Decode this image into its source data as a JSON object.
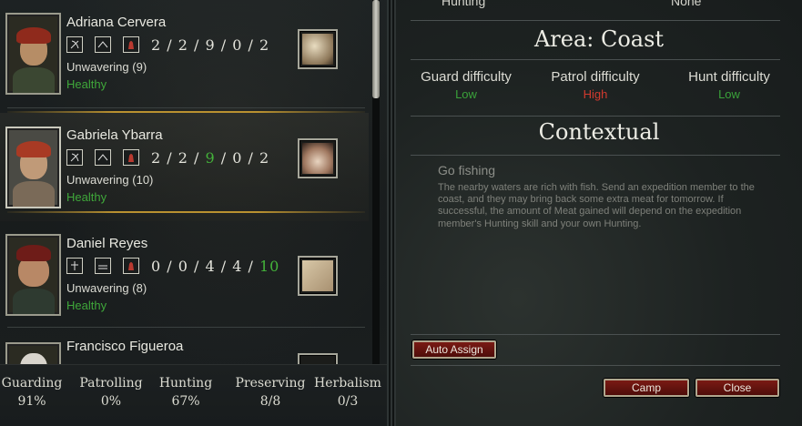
{
  "roster": [
    {
      "name": "Adriana Cervera",
      "stats": [
        "2",
        "2",
        "9",
        "0",
        "2"
      ],
      "stat_highlight": [],
      "trait": "Unwavering (9)",
      "status": "Healthy",
      "skill_icons": [
        "bow-icon",
        "tent-icon",
        "hood-icon"
      ]
    },
    {
      "name": "Gabriela Ybarra",
      "stats": [
        "2",
        "2",
        "9",
        "0",
        "2"
      ],
      "stat_highlight": [
        2
      ],
      "trait": "Unwavering (10)",
      "status": "Healthy",
      "skill_icons": [
        "bow-icon",
        "tent-icon",
        "hood-icon"
      ]
    },
    {
      "name": "Daniel Reyes",
      "stats": [
        "0",
        "0",
        "4",
        "4",
        "10"
      ],
      "stat_highlight": [
        4
      ],
      "trait": "Unwavering (8)",
      "status": "Healthy",
      "skill_icons": [
        "cross-icon",
        "bed-icon",
        "hood-icon"
      ]
    },
    {
      "name": "Francisco Figueroa",
      "stats": [],
      "stat_highlight": [],
      "trait": "",
      "status": "",
      "skill_icons": []
    }
  ],
  "summary": [
    {
      "label": "Guarding",
      "value": "91%"
    },
    {
      "label": "Patrolling",
      "value": "0%"
    },
    {
      "label": "Hunting",
      "value": "67%"
    },
    {
      "label": "Preserving",
      "value": "8/8"
    },
    {
      "label": "Herbalism",
      "value": "0/3"
    }
  ],
  "assignment_row": {
    "label": "Hunting",
    "value": "None"
  },
  "area": {
    "title": "Area: Coast",
    "difficulties": [
      {
        "label": "Guard difficulty",
        "value": "Low",
        "color": "#3aa23a"
      },
      {
        "label": "Patrol difficulty",
        "value": "High",
        "color": "#d23a2e"
      },
      {
        "label": "Hunt difficulty",
        "value": "Low",
        "color": "#3aa23a"
      }
    ]
  },
  "contextual": {
    "title": "Contextual",
    "action_title": "Go fishing",
    "action_description": "The nearby waters are rich with fish. Send an expedition member to the coast, and they may bring back some extra meat for tomorrow. If successful, the amount of Meat gained will depend on the expedition member's Hunting skill and your own Hunting."
  },
  "buttons": {
    "auto_assign": "Auto Assign",
    "camp": "Camp",
    "close": "Close"
  },
  "colors": {
    "accent_gold": "#b99130",
    "healthy": "#3fa73a",
    "button_red": "#6a1410"
  }
}
